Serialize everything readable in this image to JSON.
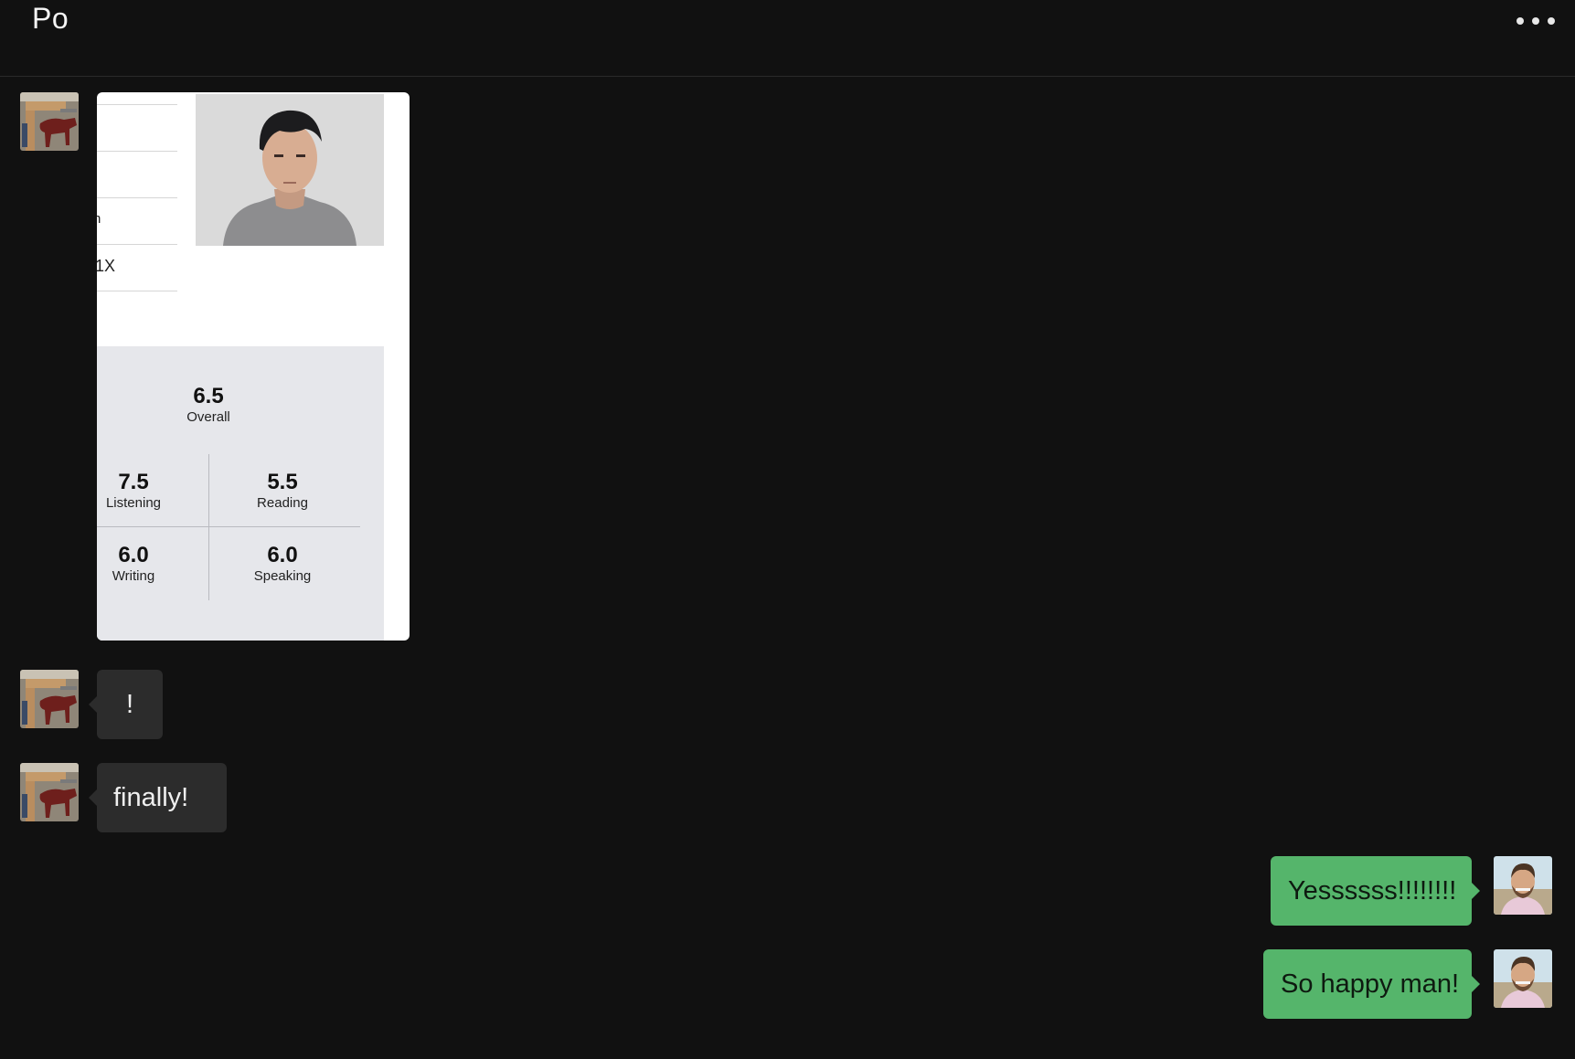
{
  "header": {
    "title": "Po",
    "more_icon": "more-horizontal-icon"
  },
  "messages": [
    {
      "side": "left",
      "kind": "image",
      "avatar": "contact-avatar",
      "card": {
        "form_fragments": [
          "n",
          "1X"
        ],
        "scores": {
          "overall": {
            "value": "6.5",
            "label": "Overall"
          },
          "listening": {
            "value": "7.5",
            "label": "Listening"
          },
          "reading": {
            "value": "5.5",
            "label": "Reading"
          },
          "writing": {
            "value": "6.0",
            "label": "Writing"
          },
          "speaking": {
            "value": "6.0",
            "label": "Speaking"
          }
        }
      }
    },
    {
      "side": "left",
      "kind": "text",
      "text": "!"
    },
    {
      "side": "left",
      "kind": "text",
      "text": "finally!"
    },
    {
      "side": "right",
      "kind": "text",
      "text": "Yessssss!!!!!!!!"
    },
    {
      "side": "right",
      "kind": "text",
      "text": "So happy man!"
    }
  ],
  "colors": {
    "background": "#111111",
    "incoming_bubble": "#2c2c2c",
    "outgoing_bubble": "#55b56b"
  }
}
